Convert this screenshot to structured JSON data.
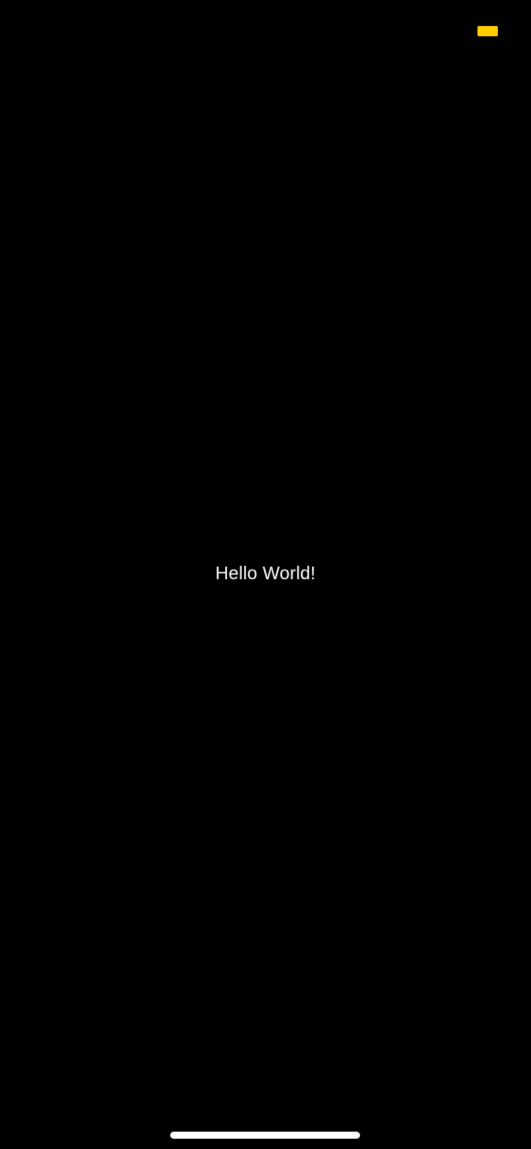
{
  "status_bar": {
    "battery_icon": "battery-icon",
    "battery_color": "#FFCC00"
  },
  "main": {
    "greeting": "Hello World!"
  },
  "home_indicator": {
    "icon": "home-indicator",
    "color": "#FFFFFF"
  },
  "colors": {
    "background": "#000000",
    "text": "#FFFFFF"
  }
}
